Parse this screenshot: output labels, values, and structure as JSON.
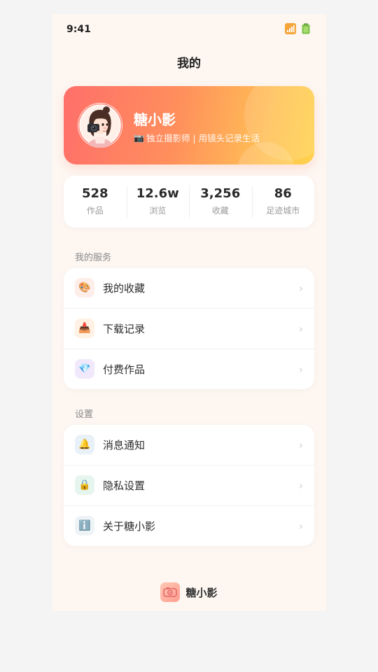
{
  "status_bar": {
    "time": "9:41"
  },
  "nav": {
    "title": "我的"
  },
  "profile": {
    "name": "糖小影",
    "bio": "独立摄影师 | 用镜头记录生活",
    "bio_icon": "📷"
  },
  "stats": [
    {
      "value": "528",
      "label": "作品"
    },
    {
      "value": "12.6w",
      "label": "浏览"
    },
    {
      "value": "3,256",
      "label": "收藏"
    },
    {
      "value": "86",
      "label": "足迹城市"
    }
  ],
  "services": {
    "title": "我的服务",
    "items": [
      {
        "label": "我的收藏",
        "icon": "🎨",
        "icon_name": "palette-icon",
        "icon_bg": "#fdeeea"
      },
      {
        "label": "下载记录",
        "icon": "📥",
        "icon_name": "download-tray-icon",
        "icon_bg": "#fff1e3"
      },
      {
        "label": "付费作品",
        "icon": "💎",
        "icon_name": "diamond-icon",
        "icon_bg": "#f1e8fb"
      }
    ]
  },
  "settings": {
    "title": "设置",
    "items": [
      {
        "label": "消息通知",
        "icon": "🔔",
        "icon_name": "bell-icon",
        "icon_bg": "#e8f1f8"
      },
      {
        "label": "隐私设置",
        "icon": "🔒",
        "icon_name": "lock-icon",
        "icon_bg": "#e6f5ee"
      },
      {
        "label": "关于糖小影",
        "icon": "ℹ️",
        "icon_name": "info-icon",
        "icon_bg": "#eef3f6"
      }
    ]
  },
  "chevron": "›",
  "footer": {
    "brand": "糖小影"
  },
  "colors": {
    "card_gradient": [
      "#ff6f6a",
      "#ff8f5c",
      "#ffbf55",
      "#ffd24b"
    ],
    "page_bg": "#fdf6f1",
    "accent": "#ff8f5c"
  }
}
